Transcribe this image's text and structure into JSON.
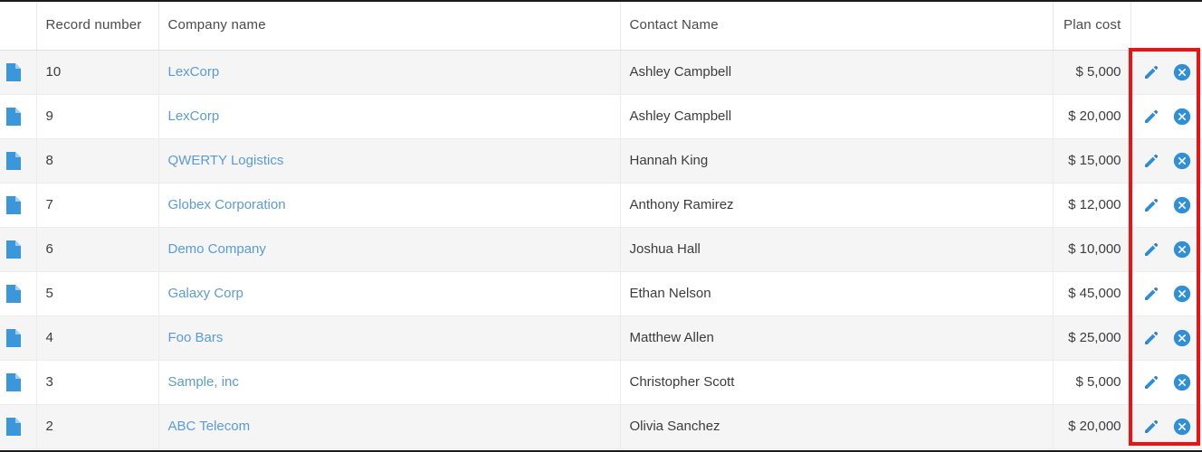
{
  "table": {
    "columns": [
      {
        "key": "icon",
        "label": ""
      },
      {
        "key": "record",
        "label": "Record number"
      },
      {
        "key": "company",
        "label": "Company name"
      },
      {
        "key": "contact",
        "label": "Contact Name"
      },
      {
        "key": "plan",
        "label": "Plan cost"
      },
      {
        "key": "actions",
        "label": ""
      }
    ],
    "rows": [
      {
        "record": "10",
        "company": "LexCorp",
        "contact": "Ashley Campbell",
        "plan": "$ 5,000"
      },
      {
        "record": "9",
        "company": "LexCorp",
        "contact": "Ashley Campbell",
        "plan": "$ 20,000"
      },
      {
        "record": "8",
        "company": "QWERTY Logistics",
        "contact": "Hannah King",
        "plan": "$ 15,000"
      },
      {
        "record": "7",
        "company": "Globex Corporation",
        "contact": "Anthony Ramirez",
        "plan": "$ 12,000"
      },
      {
        "record": "6",
        "company": "Demo Company",
        "contact": "Joshua Hall",
        "plan": "$ 10,000"
      },
      {
        "record": "5",
        "company": "Galaxy Corp",
        "contact": "Ethan Nelson",
        "plan": "$ 45,000"
      },
      {
        "record": "4",
        "company": "Foo Bars",
        "contact": "Matthew Allen",
        "plan": "$ 25,000"
      },
      {
        "record": "3",
        "company": "Sample, inc",
        "contact": "Christopher Scott",
        "plan": "$ 5,000"
      },
      {
        "record": "2",
        "company": "ABC Telecom",
        "contact": "Olivia Sanchez",
        "plan": "$ 20,000"
      }
    ],
    "row_icon": "document-icon",
    "actions": [
      {
        "name": "edit-button",
        "icon": "pencil-icon"
      },
      {
        "name": "delete-button",
        "icon": "circle-x-icon"
      }
    ]
  },
  "annotation": {
    "name": "action-column-highlight",
    "color": "#ee1111"
  },
  "colors": {
    "link": "#5b9bd5",
    "icon_blue": "#3b97db",
    "row_alt": "#f5f5f5",
    "text": "#3c3c3c",
    "header_text": "#4a4a4a"
  }
}
